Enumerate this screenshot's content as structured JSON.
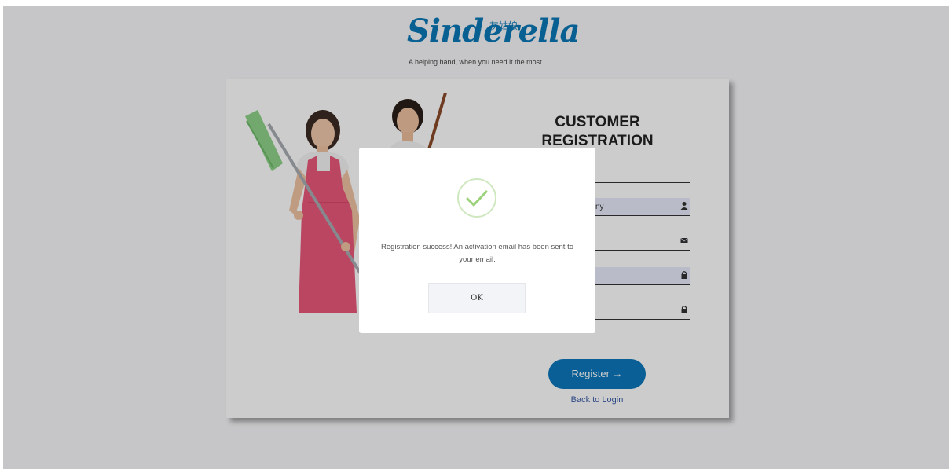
{
  "brand": {
    "logo_text": "Sinderella",
    "logo_chinese": "灰姑娘",
    "tagline": "A helping hand, when you need it the most."
  },
  "form": {
    "title_line1": "CUSTOMER",
    "title_line2": "REGISTRATION",
    "fields": [
      {
        "value": "",
        "icon": "none"
      },
      {
        "value": "ny",
        "icon": "user-icon"
      },
      {
        "value": "",
        "icon": "envelope-icon"
      },
      {
        "value": "",
        "icon": "lock-icon"
      },
      {
        "value": "",
        "icon": "lock-icon"
      }
    ],
    "register_label": "Register →",
    "back_to_login": "Back to Login"
  },
  "dialog": {
    "message": "Registration success! An activation email has been sent to your email.",
    "ok_label": "OK",
    "icon": "success-check-icon"
  },
  "colors": {
    "brand_blue": "#0a78b7",
    "register_button": "#0d78bc",
    "success_green": "#9bd27a",
    "apron_pink": "#e9587a"
  }
}
